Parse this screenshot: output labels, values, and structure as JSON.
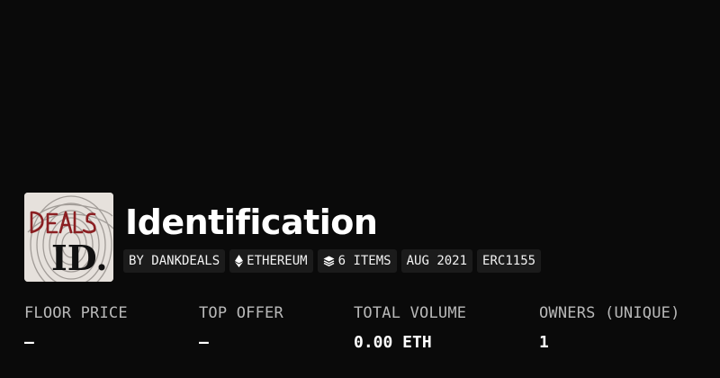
{
  "collection": {
    "title": "Identification",
    "avatar_icon": "dank-deals-id-fingerprint-logo",
    "avatar_text": "DEALS ID."
  },
  "tags": [
    {
      "label": "BY DANKDEALS"
    },
    {
      "label": "ETHEREUM",
      "icon": "ethereum-icon"
    },
    {
      "label": "6 ITEMS",
      "icon": "layers-icon"
    },
    {
      "label": "AUG 2021"
    },
    {
      "label": "ERC1155"
    }
  ],
  "stats": [
    {
      "label": "FLOOR PRICE",
      "value": "—"
    },
    {
      "label": "TOP OFFER",
      "value": "—"
    },
    {
      "label": "TOTAL VOLUME",
      "value": "0.00 ETH"
    },
    {
      "label": "OWNERS (UNIQUE)",
      "value": "1"
    }
  ],
  "colors": {
    "background": "#0a0a0a",
    "tag_background": "#1b1b1b",
    "label_text": "#b9b9b9",
    "value_text": "#ffffff"
  }
}
